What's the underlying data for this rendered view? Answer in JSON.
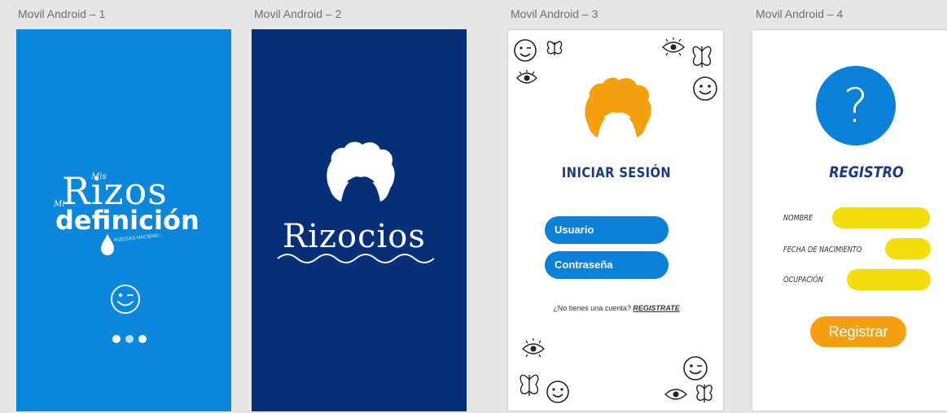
{
  "artboards": {
    "screen1": {
      "label": "Movil Android – 1"
    },
    "screen2": {
      "label": "Movil Android – 2"
    },
    "screen3": {
      "label": "Movil Android – 3"
    },
    "screen4": {
      "label": "Movil Android – 4"
    }
  },
  "screen1": {
    "logo_mis": "Mis",
    "logo_rizos": "Rizos",
    "logo_mi": "Mi",
    "logo_definicion": "definición",
    "logo_tagline": "RIZOSAS HACIEND..."
  },
  "screen2": {
    "brand": "Rizocios"
  },
  "screen3": {
    "title": "INICIAR SESIÓN",
    "username_label": "Usuario",
    "password_label": "Contraseña",
    "no_account_text": "¿No tienes una cuenta?",
    "register_link": "REGISTRATE"
  },
  "screen4": {
    "icon_glyph": "?",
    "title": "REGISTRO",
    "name_label": "NOMBRE",
    "birth_label": "FECHA DE NACIMIENTO",
    "occupation_label": "OCUPACIÓN",
    "register_button": "Registrar"
  },
  "colors": {
    "screen1_bg": "#0a86da",
    "screen2_bg": "#052f78",
    "primary_blue": "#0a80d8",
    "title_navy": "#1a3a86",
    "field_yellow": "#f5dd0c",
    "button_orange": "#f7a00f",
    "hair_orange": "#f7a00f"
  }
}
